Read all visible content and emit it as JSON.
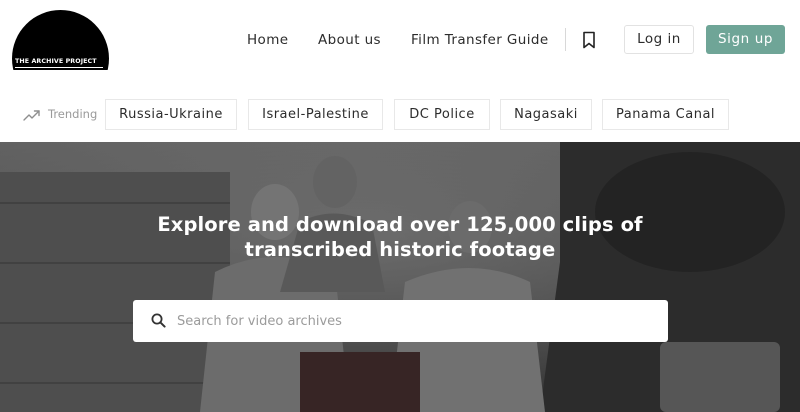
{
  "logo": {
    "text": "THE ARCHIVE PROJECT"
  },
  "nav": {
    "home": "Home",
    "about": "About us",
    "guide": "Film Transfer Guide",
    "login": "Log in",
    "signup": "Sign up"
  },
  "trending": {
    "label": "Trending",
    "items": [
      "Russia-Ukraine",
      "Israel-Palestine",
      "DC Police",
      "Nagasaki",
      "Panama Canal"
    ]
  },
  "hero": {
    "title": "Explore and download over 125,000 clips of transcribed historic footage"
  },
  "search": {
    "placeholder": "Search for video archives",
    "value": ""
  },
  "icons": {
    "bookmark": "bookmark-icon",
    "trending": "trending-up-icon",
    "search": "search-icon"
  },
  "colors": {
    "accent": "#6fa597",
    "logo_background": "#000000"
  }
}
